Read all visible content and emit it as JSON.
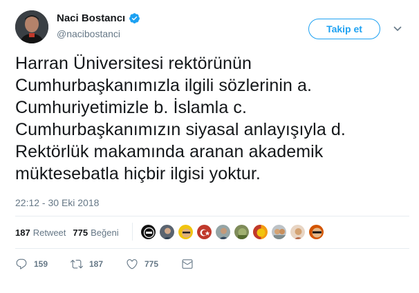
{
  "user": {
    "name": "Naci Bostancı",
    "handle": "@nacibostanci",
    "verified_icon": "verified-badge-icon"
  },
  "follow_button": {
    "label": "Takip et"
  },
  "tweet": {
    "lines": [
      "Harran Üniversitesi rektörünün",
      "Cumhurbaşkanımızla ilgili sözlerinin a.",
      "Cumhuriyetimizle b. İslamla c.",
      "Cumhurbaşkanımızın siyasal anlayışıyla d.",
      "Rektörlük makamında aranan akademik",
      "müktesebatla hiçbir ilgisi yoktur."
    ],
    "timestamp": "22:12 - 30 Eki 2018"
  },
  "stats": {
    "retweets": {
      "count": "187",
      "label": "Retweet"
    },
    "likes": {
      "count": "775",
      "label": "Beğeni"
    }
  },
  "actions": {
    "reply_count": "159",
    "retweet_count": "187",
    "like_count": "775"
  },
  "colors": {
    "accent": "#1da1f2",
    "muted": "#657786",
    "text": "#14171a",
    "border": "#e6ecf0"
  }
}
